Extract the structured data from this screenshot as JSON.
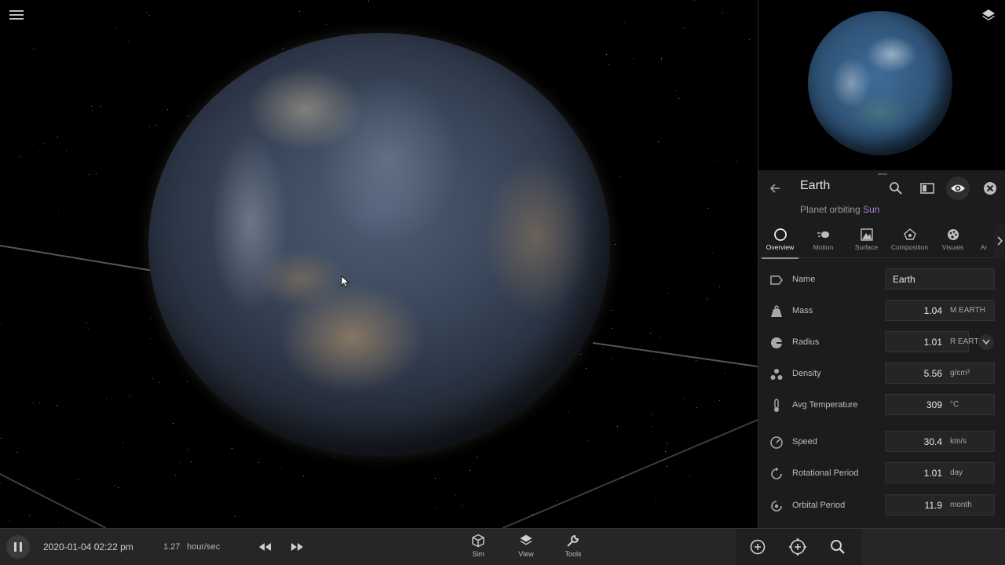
{
  "viewport": {
    "menu_icon": "hamburger-menu-icon",
    "cursor_icon": "mouse-pointer-icon"
  },
  "preview": {
    "layers_icon": "layers-icon"
  },
  "panel": {
    "title": "Earth",
    "subtitle_prefix": "Planet orbiting",
    "subtitle_link": "Sun",
    "header_icons": [
      "back-arrow-icon",
      "search-icon",
      "panel-icon",
      "eye-icon",
      "close-icon"
    ]
  },
  "tabs": [
    {
      "label": "Overview",
      "icon": "circle-icon",
      "active": true
    },
    {
      "label": "Motion",
      "icon": "motion-icon",
      "active": false
    },
    {
      "label": "Surface",
      "icon": "surface-icon",
      "active": false
    },
    {
      "label": "Composition",
      "icon": "composition-icon",
      "active": false
    },
    {
      "label": "Visuals",
      "icon": "palette-icon",
      "active": false
    },
    {
      "label": "Ar",
      "icon": "",
      "active": false
    }
  ],
  "properties": [
    {
      "label": "Name",
      "value": "Earth",
      "unit": "",
      "icon": "tag-icon"
    },
    {
      "label": "Mass",
      "value": "1.04",
      "unit": "M EARTH",
      "icon": "weight-icon"
    },
    {
      "label": "Radius",
      "value": "1.01",
      "unit": "R EARTH",
      "icon": "radius-icon"
    },
    {
      "label": "Density",
      "value": "5.56",
      "unit": "g/cm³",
      "icon": "density-icon"
    },
    {
      "label": "Avg Temperature",
      "value": "309",
      "unit": "°C",
      "icon": "thermometer-icon"
    },
    {
      "label": "Speed",
      "value": "30.4",
      "unit": "km/s",
      "icon": "speedometer-icon"
    },
    {
      "label": "Rotational Period",
      "value": "1.01",
      "unit": "day",
      "icon": "rotation-icon"
    },
    {
      "label": "Orbital Period",
      "value": "11.9",
      "unit": "month",
      "icon": "orbit-icon"
    }
  ],
  "bottom": {
    "date": "2020-01-04 02:22 pm",
    "rate_value": "1.27",
    "rate_unit": "hour/sec",
    "tools": [
      {
        "label": "Sim",
        "icon": "cube-icon"
      },
      {
        "label": "View",
        "icon": "layers-icon"
      },
      {
        "label": "Tools",
        "icon": "wrench-icon"
      }
    ],
    "right_icons": [
      "add-icon",
      "move-add-icon",
      "search-icon"
    ],
    "transport_icons": [
      "pause-icon",
      "rewind-icon",
      "fast-forward-icon"
    ]
  },
  "colors": {
    "panel_bg": "#1c1c1c",
    "bottom_bar_bg": "#262626",
    "link_accent": "#a785d8"
  }
}
